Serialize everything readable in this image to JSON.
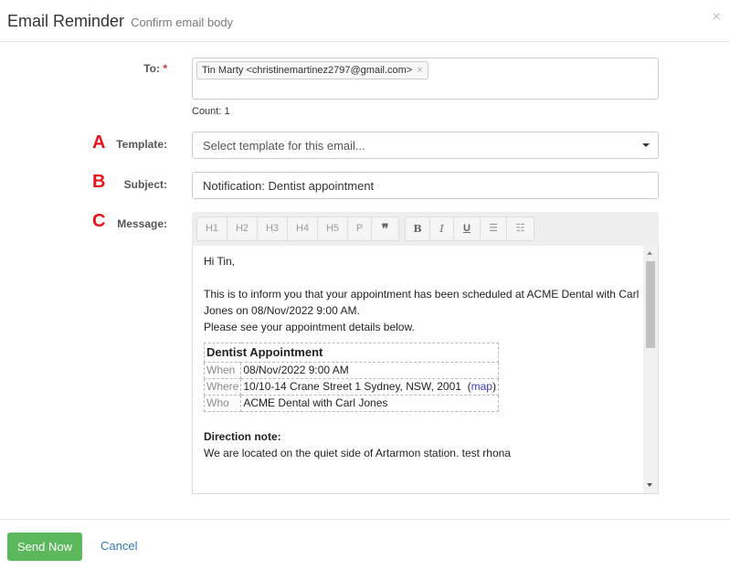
{
  "header": {
    "title": "Email Reminder",
    "subtitle": "Confirm email body",
    "close": "×"
  },
  "to": {
    "label": "To:",
    "required": "*",
    "recipient": "Tin Marty <christinemartinez2797@gmail.com>",
    "remove": "×",
    "count": "Count: 1"
  },
  "template": {
    "letter": "A",
    "label": "Template:",
    "placeholder": "Select template for this email..."
  },
  "subject": {
    "letter": "B",
    "label": "Subject:",
    "value": "Notification: Dentist appointment"
  },
  "message": {
    "letter": "C",
    "label": "Message:",
    "toolbar": [
      "H1",
      "H2",
      "H3",
      "H4",
      "H5",
      "P",
      "❞",
      "B",
      "I",
      "U",
      "☰",
      "☷"
    ],
    "greeting": "Hi Tin,",
    "para1": "This is to inform you that your appointment has been scheduled at ACME Dental with Carl Jones on 08/Nov/2022 9:00 AM.",
    "para2": "Please see your appointment details below.",
    "appt": {
      "title": "Dentist Appointment",
      "when_label": "When",
      "when": "08/Nov/2022 9:00 AM",
      "where_label": "Where",
      "where": "10/10-14 Crane Street 1 Sydney, NSW, 2001",
      "map": "map",
      "who_label": "Who",
      "who": "ACME Dental with Carl Jones"
    },
    "direction_title": "Direction note:",
    "direction": "We are located on the quiet side of Artarmon station. test rhona"
  },
  "footer": {
    "send": "Send Now",
    "cancel": "Cancel"
  }
}
